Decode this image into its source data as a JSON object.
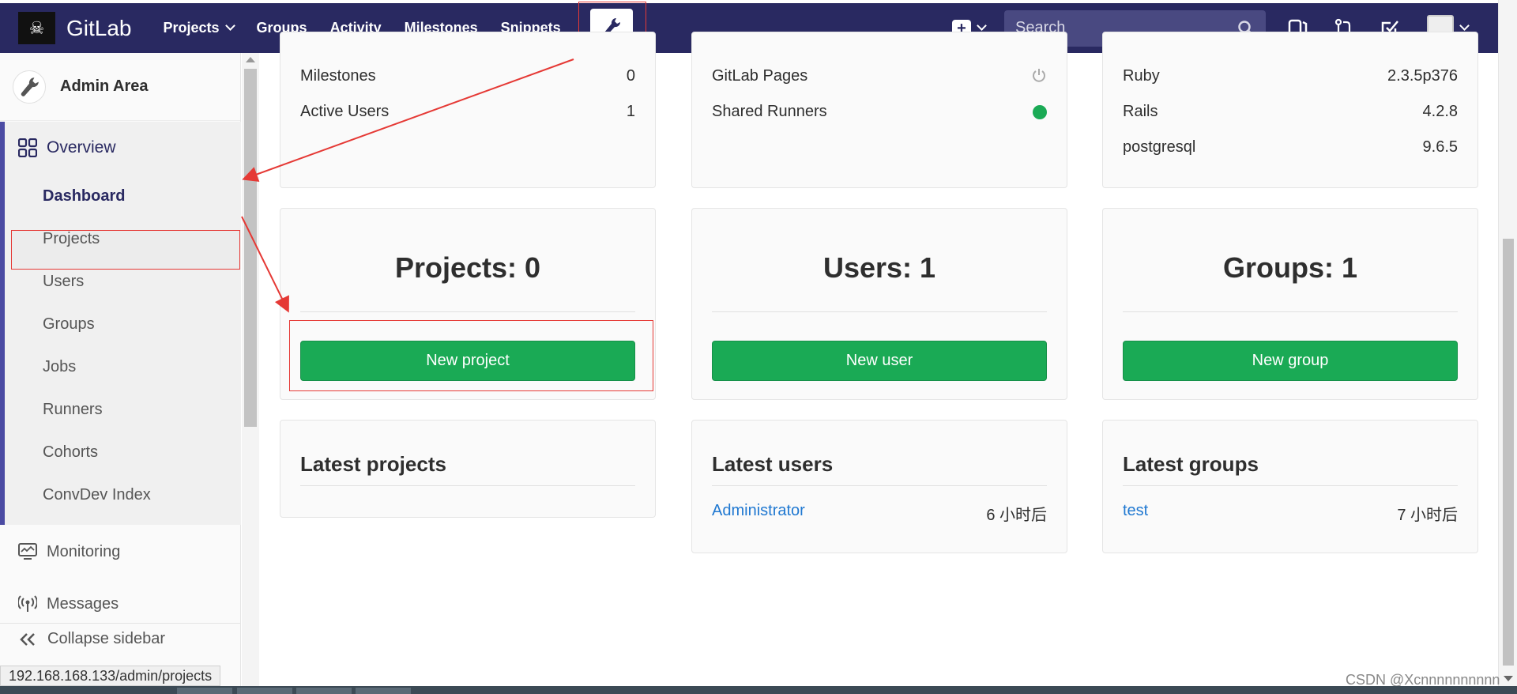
{
  "navbar": {
    "brand": "GitLab",
    "links": [
      "Projects",
      "Groups",
      "Activity",
      "Milestones",
      "Snippets"
    ],
    "search_placeholder": "Search",
    "icons": [
      "wrench-icon",
      "plus-icon",
      "search-icon",
      "sidebar-toggle-icon",
      "merge-request-icon",
      "todo-icon",
      "avatar"
    ]
  },
  "sidebar": {
    "header": "Admin Area",
    "overview": "Overview",
    "overview_items": [
      "Dashboard",
      "Projects",
      "Users",
      "Groups",
      "Jobs",
      "Runners",
      "Cohorts",
      "ConvDev Index"
    ],
    "monitoring": "Monitoring",
    "messages": "Messages",
    "collapse": "Collapse sidebar"
  },
  "stats_card": {
    "rows": [
      {
        "label": "Milestones",
        "value": "0"
      },
      {
        "label": "Active Users",
        "value": "1"
      }
    ]
  },
  "features_card": {
    "rows": [
      {
        "label": "GitLab Pages",
        "status": "power-icon"
      },
      {
        "label": "Shared Runners",
        "status": "green-dot"
      }
    ]
  },
  "components_card": {
    "rows": [
      {
        "label": "Ruby",
        "value": "2.3.5p376"
      },
      {
        "label": "Rails",
        "value": "4.2.8"
      },
      {
        "label": "postgresql",
        "value": "9.6.5"
      }
    ]
  },
  "counts": {
    "projects": {
      "title": "Projects: 0",
      "button": "New project"
    },
    "users": {
      "title": "Users: 1",
      "button": "New user"
    },
    "groups": {
      "title": "Groups: 1",
      "button": "New group"
    }
  },
  "latest": {
    "projects": {
      "title": "Latest projects"
    },
    "users": {
      "title": "Latest users",
      "name": "Administrator",
      "time": "6 小时后"
    },
    "groups": {
      "title": "Latest groups",
      "name": "test",
      "time": "7 小时后"
    }
  },
  "statusbar": "192.168.168.133/admin/projects",
  "watermark": "CSDN @Xcnnnnnnnnnn",
  "colors": {
    "navbar": "#292961",
    "accent": "#4b4ba3",
    "button": "#1aaa55",
    "link": "#1f78d1",
    "annotation": "#e53935"
  }
}
